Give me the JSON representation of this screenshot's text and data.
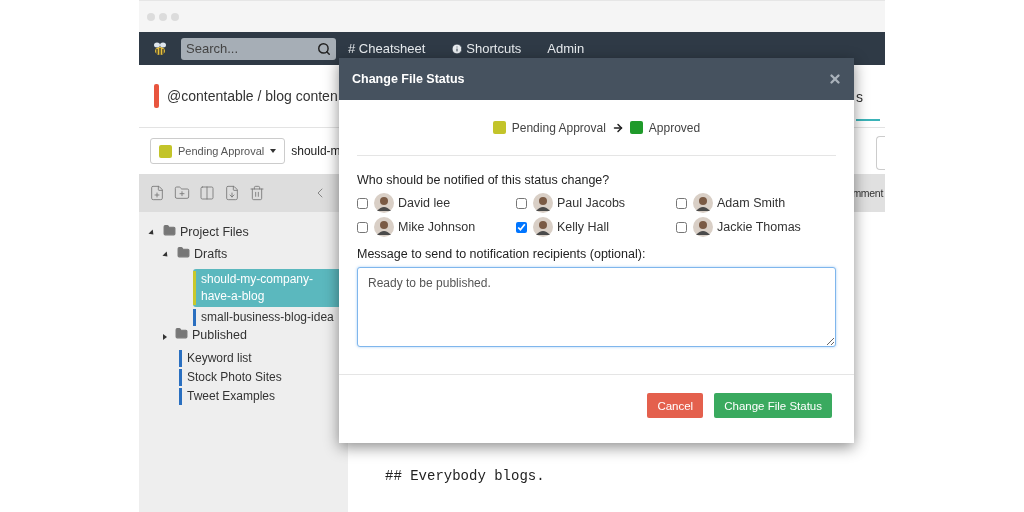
{
  "navbar": {
    "search": {
      "placeholder": "Search..."
    },
    "links": [
      {
        "label": "# Cheatsheet",
        "kind": "text"
      },
      {
        "label": "Shortcuts",
        "kind": "info"
      },
      {
        "label": "Admin",
        "kind": "text"
      }
    ]
  },
  "project": {
    "title": "@contentable / blog conten",
    "tab_fragment": "s"
  },
  "file_bar": {
    "status": {
      "label": "Pending Approval",
      "color": "#c3c42a"
    },
    "file_name": "should-m"
  },
  "sidebar": {
    "tree": [
      {
        "label": "Project Files",
        "kind": "folder",
        "expanded": true,
        "children": [
          {
            "label": "Drafts",
            "kind": "folder",
            "expanded": true,
            "children": [
              {
                "label": "should-my-company-have-a-blog",
                "kind": "file",
                "selected": true,
                "color": "#c8c82c"
              },
              {
                "label": "small-business-blog-idea",
                "kind": "file",
                "selected": false,
                "color": "#2a6fc0"
              }
            ]
          },
          {
            "label": "Published",
            "kind": "folder",
            "expanded": false
          },
          {
            "label": "Keyword list",
            "kind": "file",
            "selected": false,
            "color": "#2a6fc0"
          },
          {
            "label": "Stock Photo Sites",
            "kind": "file",
            "selected": false,
            "color": "#2a6fc0"
          },
          {
            "label": "Tweet Examples",
            "kind": "file",
            "selected": false,
            "color": "#2a6fc0"
          }
        ]
      }
    ]
  },
  "editor": {
    "toolbar_fragment": "mment",
    "text": "## Everybody blogs."
  },
  "modal": {
    "title": "Change File Status",
    "status_change": {
      "from": {
        "label": "Pending Approval",
        "color": "#c3c42a"
      },
      "to": {
        "label": "Approved",
        "color": "#1f9a2a"
      }
    },
    "question": "Who should be notified of this status change?",
    "recipients": [
      {
        "name": "David lee",
        "checked": false
      },
      {
        "name": "Paul Jacobs",
        "checked": false
      },
      {
        "name": "Adam Smith",
        "checked": false
      },
      {
        "name": "Mike Johnson",
        "checked": false
      },
      {
        "name": "Kelly Hall",
        "checked": true
      },
      {
        "name": "Jackie Thomas",
        "checked": false
      }
    ],
    "message_label": "Message to send to notification recipients (optional):",
    "message": {
      "value": "Ready to be published."
    },
    "buttons": [
      {
        "label": "Cancel",
        "kind": "danger"
      },
      {
        "label": "Change File Status",
        "kind": "primary"
      }
    ]
  }
}
